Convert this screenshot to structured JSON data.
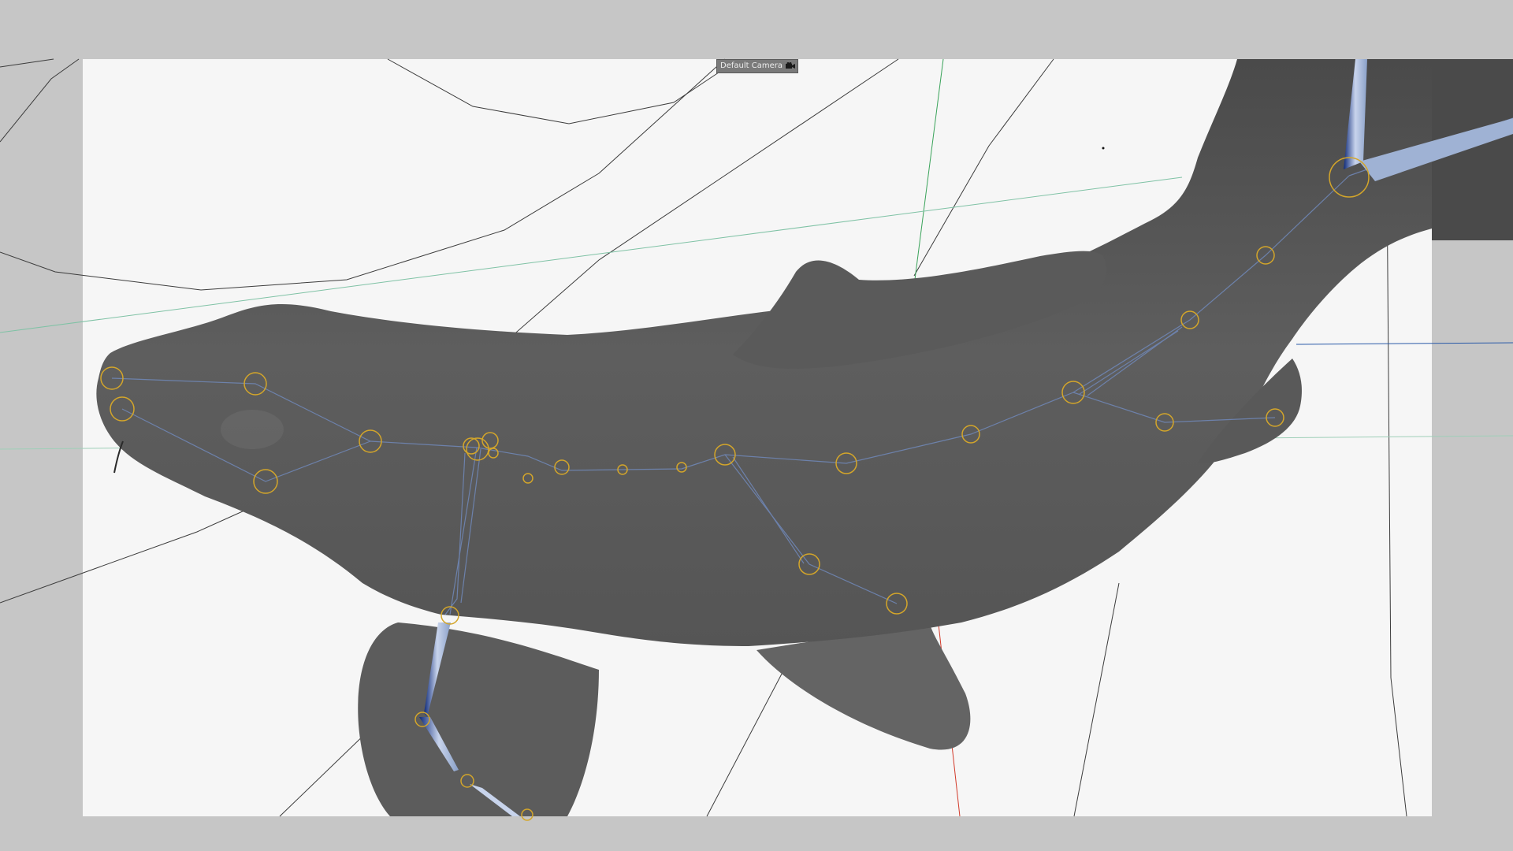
{
  "viewport": {
    "camera_name": "Default Camera",
    "camera_icon": "camera-icon",
    "background_color": "#c6c6c6",
    "frame_color": "#f6f6f6",
    "model_color": "#5a5a5a",
    "joint_color": "#d4a62a",
    "bone_color": "#6f86b4",
    "axis_x_color": "#d23a2a",
    "axis_y_color": "#3aa35a",
    "axis_z_color": "#2a5aa8"
  }
}
